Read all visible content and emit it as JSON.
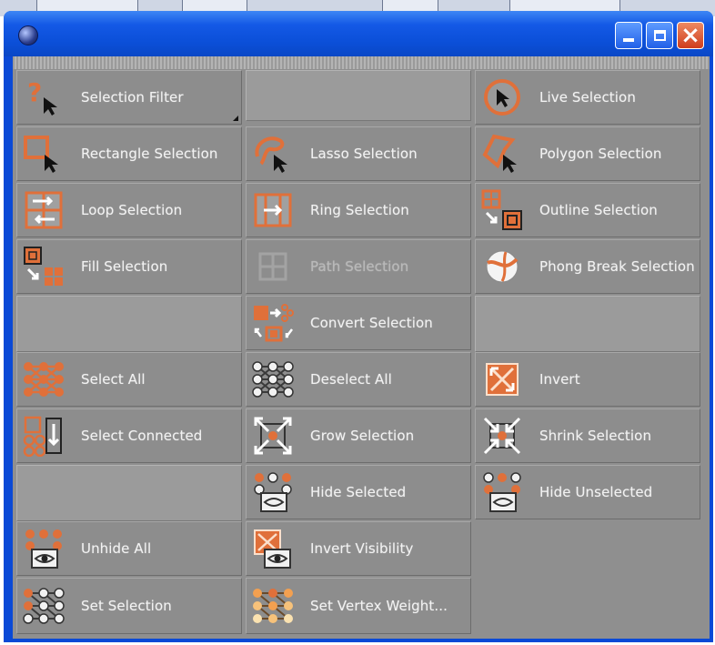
{
  "window": {
    "close_glyph": "×"
  },
  "tools": {
    "selection_filter": "Selection Filter",
    "live_selection": "Live Selection",
    "rectangle_selection": "Rectangle Selection",
    "lasso_selection": "Lasso Selection",
    "polygon_selection": "Polygon Selection",
    "loop_selection": "Loop Selection",
    "ring_selection": "Ring Selection",
    "outline_selection": "Outline Selection",
    "fill_selection": "Fill Selection",
    "path_selection": "Path Selection",
    "phong_break_selection": "Phong Break Selection",
    "convert_selection": "Convert Selection",
    "select_all": "Select All",
    "deselect_all": "Deselect All",
    "invert": "Invert",
    "select_connected": "Select Connected",
    "grow_selection": "Grow Selection",
    "shrink_selection": "Shrink Selection",
    "hide_selected": "Hide Selected",
    "hide_unselected": "Hide Unselected",
    "unhide_all": "Unhide All",
    "invert_visibility": "Invert Visibility",
    "set_selection": "Set Selection",
    "set_vertex_weight": "Set Vertex Weight..."
  },
  "colors": {
    "accent_orange": "#e0703a",
    "panel_gray": "#8d8d8d",
    "title_blue": "#0b4fd8",
    "close_red": "#d9472a"
  }
}
